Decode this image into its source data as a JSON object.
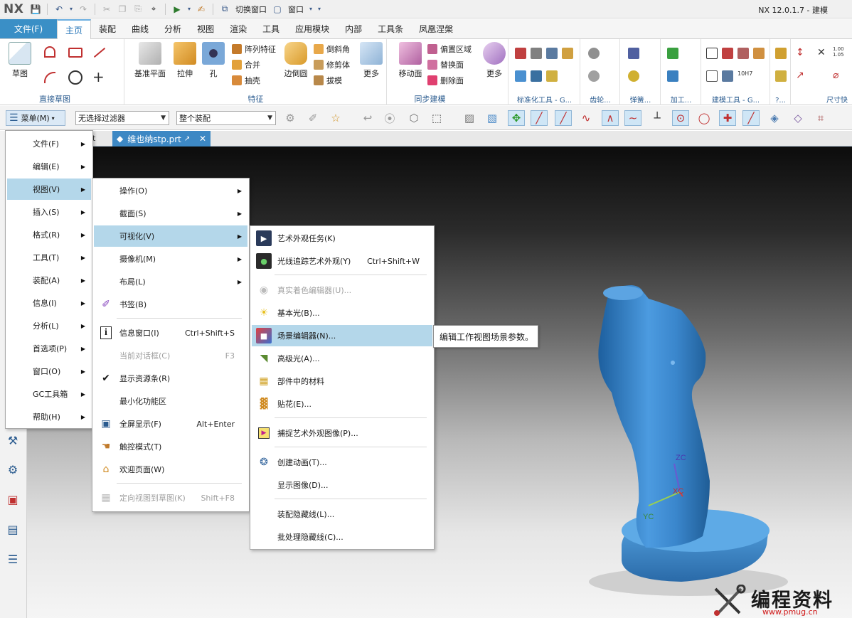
{
  "app": {
    "logo": "NX",
    "version_title": "NX 12.0.1.7 - 建模",
    "quick_access": {
      "switch_window": "切换窗口",
      "window": "窗口"
    }
  },
  "ribbon_tabs": [
    "文件(F)",
    "主页",
    "装配",
    "曲线",
    "分析",
    "视图",
    "渲染",
    "工具",
    "应用模块",
    "内部",
    "工具条",
    "凤凰涅槃"
  ],
  "ribbon": {
    "sketch_label": "草图",
    "direct_sketch_group": "直接草图",
    "datum_plane": "基准平面",
    "extrude": "拉伸",
    "hole": "孔",
    "pattern_feature": "阵列特征",
    "unite": "合并",
    "shell": "抽壳",
    "edge_blend": "边倒圆",
    "chamfer": "倒斜角",
    "trim_body": "修剪体",
    "draft": "拔模",
    "more": "更多",
    "feature_group": "特征",
    "move_face": "移动面",
    "offset_region": "偏置区域",
    "replace_face": "替换面",
    "delete_face": "删除面",
    "sync_group": "同步建模",
    "std_tools": "标准化工具 - G...",
    "gear": "齿轮...",
    "spring": "弹簧...",
    "machining": "加工...",
    "modeling_tools": "建模工具 - G...",
    "misc": "?...",
    "dims": "尺寸快",
    "tiny_labels": [
      "1.00",
      "1.05",
      "10H7"
    ]
  },
  "selbar": {
    "menu_button": "菜单(M)",
    "filter": "无选择过滤器",
    "scope": "整个装配"
  },
  "doc_tab": {
    "name": "维也纳stp.prt",
    "hidden_prefix": "t"
  },
  "main_menu": [
    "文件(F)",
    "编辑(E)",
    "视图(V)",
    "插入(S)",
    "格式(R)",
    "工具(T)",
    "装配(A)",
    "信息(I)",
    "分析(L)",
    "首选项(P)",
    "窗口(O)",
    "GC工具箱",
    "帮助(H)"
  ],
  "view_menu": {
    "operation": "操作(O)",
    "section": "截面(S)",
    "visualization": "可视化(V)",
    "camera": "摄像机(M)",
    "layout": "布局(L)",
    "bookmark": "书签(B)",
    "info_window": "信息窗口(I)",
    "info_window_sc": "Ctrl+Shift+S",
    "current_dialog": "当前对话框(C)",
    "current_dialog_sc": "F3",
    "show_resource_bar": "显示资源条(R)",
    "minimize_ribbon": "最小化功能区",
    "fullscreen": "全屏显示(F)",
    "fullscreen_sc": "Alt+Enter",
    "touch_mode": "触控模式(T)",
    "welcome_page": "欢迎页面(W)",
    "orient_view": "定向视图到草图(K)",
    "orient_view_sc": "Shift+F8"
  },
  "vis_menu": {
    "artistic_task": "艺术外观任务(K)",
    "ray_traced": "光线追踪艺术外观(Y)",
    "ray_traced_sc": "Ctrl+Shift+W",
    "true_shading": "真实着色编辑器(U)...",
    "basic_light": "基本光(B)...",
    "scene_editor": "场景编辑器(N)...",
    "advanced_light": "高级光(A)...",
    "materials_in_part": "部件中的材料",
    "decal": "贴花(E)...",
    "capture_image": "捕捉艺术外观图像(P)...",
    "create_animation": "创建动画(T)...",
    "show_image": "显示图像(D)...",
    "assembly_hidden": "装配隐藏线(L)...",
    "batch_hidden": "批处理隐藏线(C)..."
  },
  "tooltip": {
    "scene_editor": "编辑工作视图场景参数。"
  },
  "triad": {
    "zc": "ZC",
    "xc": "XC",
    "yc": "YC"
  },
  "watermark": {
    "title": "编程资料网",
    "url": "www.pmug.cn"
  },
  "colors": {
    "accent": "#3a8fc6",
    "highlight": "#b4d7ea",
    "model": "#3f8fd2"
  }
}
